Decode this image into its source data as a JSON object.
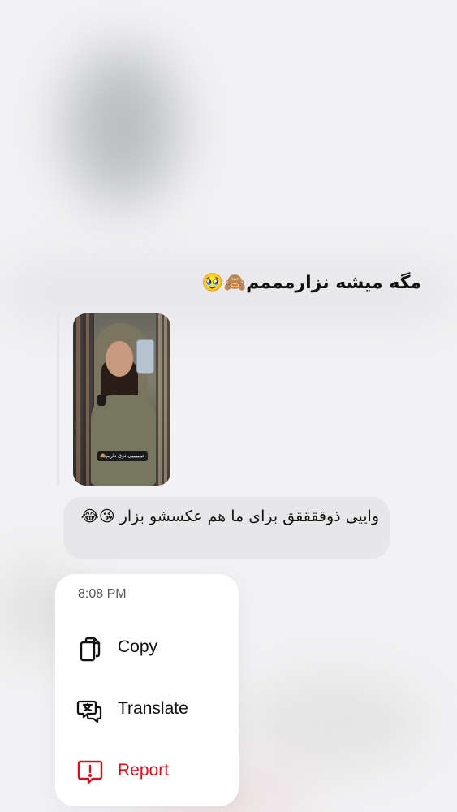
{
  "messages": {
    "top_text": "مگه میشه نزارمممم🙈🥹",
    "story_caption": "خیلیییییی ذوق داریم🙈",
    "reply_text": "واییی ذوققققق برای ما هم عکسشو بزار 😘😂"
  },
  "context_menu": {
    "time": "8:08 PM",
    "items": [
      {
        "label": "Copy",
        "icon": "copy-icon"
      },
      {
        "label": "Translate",
        "icon": "translate-icon"
      },
      {
        "label": "Report",
        "icon": "report-icon",
        "color": "#d3121d"
      }
    ]
  }
}
